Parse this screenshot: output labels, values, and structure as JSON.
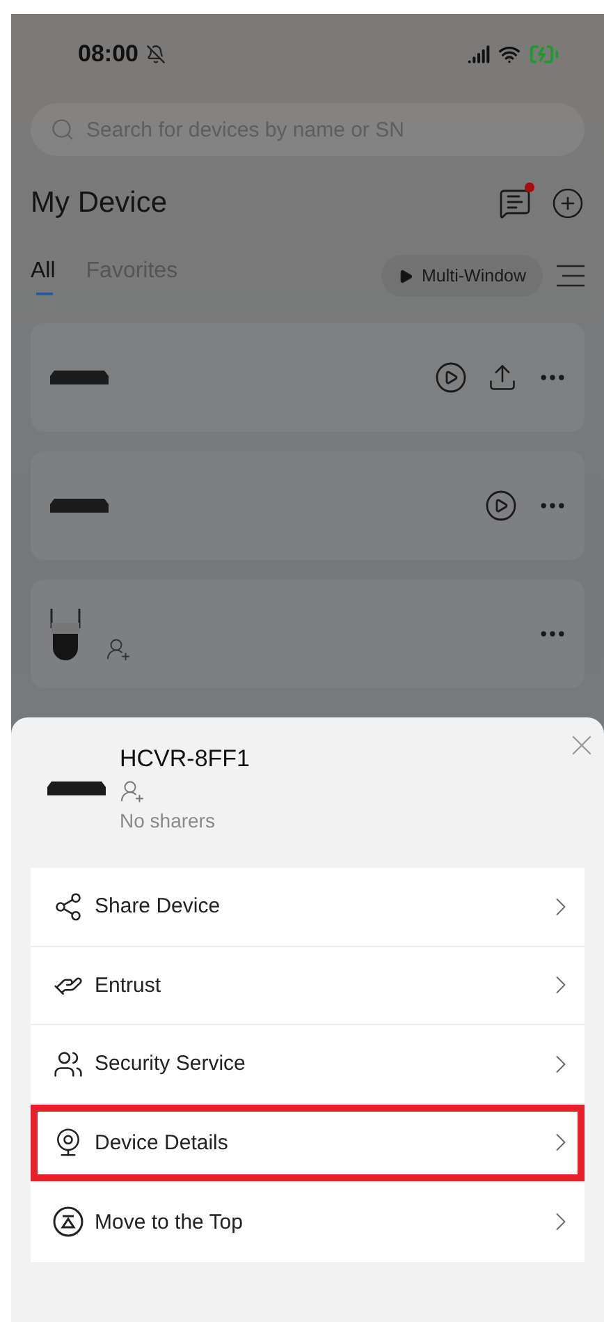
{
  "status_bar": {
    "time": "08:00"
  },
  "search": {
    "placeholder": "Search for devices by name or SN"
  },
  "header": {
    "title": "My Device",
    "has_notification": true
  },
  "tabs": [
    {
      "label": "All",
      "selected": true
    },
    {
      "label": "Favorites",
      "selected": false
    }
  ],
  "multi_window": {
    "label": "Multi-Window"
  },
  "devices": [
    {
      "kind": "recorder",
      "shared": false,
      "actions": [
        {
          "kind": "play"
        },
        {
          "kind": "upload"
        },
        {
          "kind": "more"
        }
      ]
    },
    {
      "kind": "recorder",
      "shared": false,
      "actions": [
        {
          "kind": "play"
        },
        {
          "kind": "more"
        }
      ]
    },
    {
      "kind": "camera",
      "shared": true,
      "actions": [
        {
          "kind": "more"
        }
      ]
    }
  ],
  "sheet": {
    "device_name": "HCVR-8FF1",
    "sharers": "No sharers",
    "menu": [
      {
        "kind": "share",
        "label": "Share Device",
        "highlighted": false
      },
      {
        "kind": "entrust",
        "label": "Entrust",
        "highlighted": false
      },
      {
        "kind": "security",
        "label": "Security Service",
        "highlighted": false
      },
      {
        "kind": "details",
        "label": "Device Details",
        "highlighted": true
      },
      {
        "kind": "top",
        "label": "Move to the Top",
        "highlighted": false
      }
    ]
  }
}
